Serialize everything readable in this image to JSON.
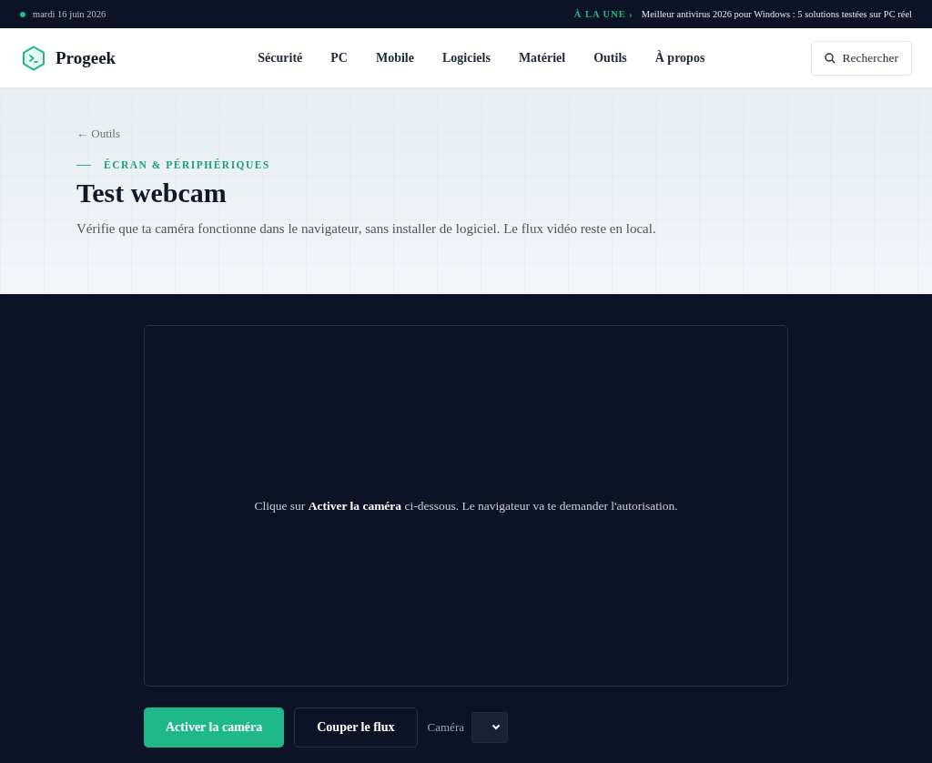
{
  "topbar": {
    "date": "mardi 16 juin 2026",
    "headline_label": "À LA UNE ›",
    "headline": "Meilleur antivirus 2026 pour Windows : 5 solutions testées sur PC réel"
  },
  "header": {
    "logo": "Progeek",
    "nav": [
      "Sécurité",
      "PC",
      "Mobile",
      "Logiciels",
      "Matériel",
      "Outils",
      "À propos"
    ],
    "search_button": "Rechercher"
  },
  "hero": {
    "breadcrumb": "← Outils",
    "kicker": "ÉCRAN & PÉRIPHÉRIQUES",
    "title": "Test webcam",
    "intro": "Vérifie que ta caméra fonctionne dans le navigateur, sans installer de logiciel. Le flux vidéo reste en local."
  },
  "webcam": {
    "message": "Clique sur **Activer la caméra** ci-dessous. Le navigateur va te demander l'autorisation.",
    "buttons": [
      {
        "label": "Activer la caméra",
        "kind": "primary"
      },
      {
        "label": "Couper le flux",
        "kind": "secondary"
      }
    ],
    "camera_label": "Caméra"
  }
}
